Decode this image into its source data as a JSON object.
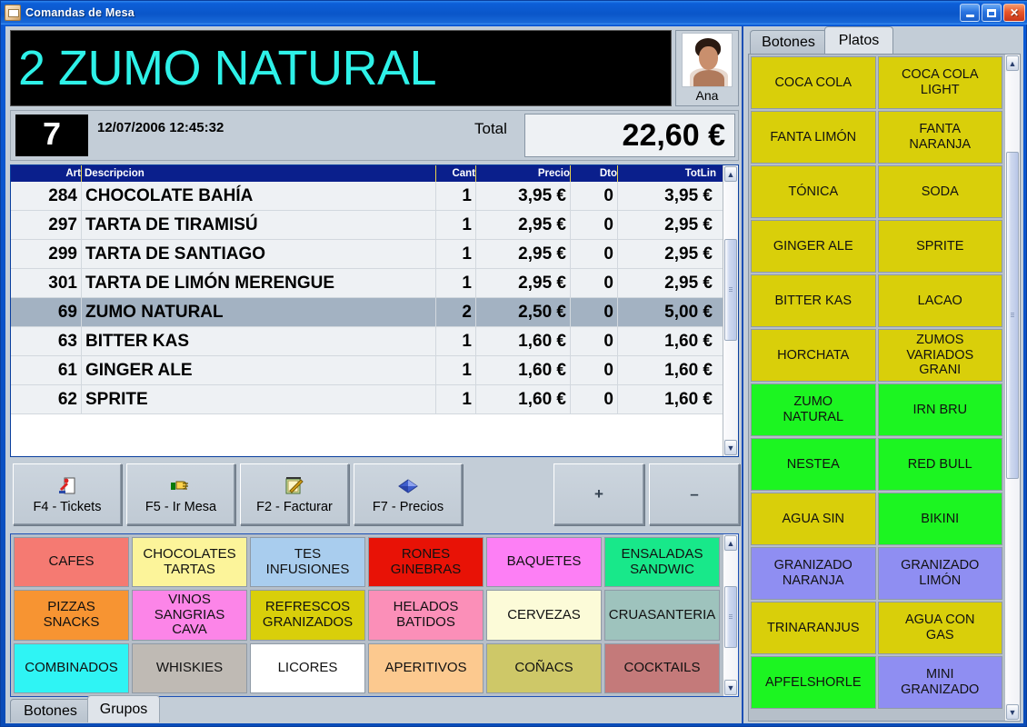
{
  "window": {
    "title": "Comandas de Mesa",
    "icon": "app-icon",
    "controls": {
      "minimize": "minimize-icon",
      "maximize": "maximize-icon",
      "close": "close-icon"
    }
  },
  "display": {
    "line": "2 ZUMO NATURAL",
    "color": "#2ef1e8"
  },
  "user": {
    "name": "Ana",
    "photo": "user-photo"
  },
  "info": {
    "table_number": "7",
    "datetime": "12/07/2006 12:45:32",
    "total_label": "Total",
    "total_value": "22,60 €"
  },
  "order_table": {
    "columns": [
      "Art",
      "Descripcion",
      "Cant",
      "Precio",
      "Dto",
      "TotLin"
    ],
    "header_bg": "#0a1f8c",
    "selected_row_bg": "#a3b2c2",
    "rows": [
      {
        "art": "284",
        "desc": "CHOCOLATE BAHÍA",
        "cant": "1",
        "precio": "3,95 €",
        "dto": "0",
        "totlin": "3,95 €",
        "selected": false
      },
      {
        "art": "297",
        "desc": "TARTA DE TIRAMISÚ",
        "cant": "1",
        "precio": "2,95 €",
        "dto": "0",
        "totlin": "2,95 €",
        "selected": false
      },
      {
        "art": "299",
        "desc": "TARTA DE SANTIAGO",
        "cant": "1",
        "precio": "2,95 €",
        "dto": "0",
        "totlin": "2,95 €",
        "selected": false
      },
      {
        "art": "301",
        "desc": "TARTA DE LIMÓN MERENGUE",
        "cant": "1",
        "precio": "2,95 €",
        "dto": "0",
        "totlin": "2,95 €",
        "selected": false
      },
      {
        "art": "69",
        "desc": "ZUMO NATURAL",
        "cant": "2",
        "precio": "2,50 €",
        "dto": "0",
        "totlin": "5,00 €",
        "selected": true
      },
      {
        "art": "63",
        "desc": "BITTER KAS",
        "cant": "1",
        "precio": "1,60 €",
        "dto": "0",
        "totlin": "1,60 €",
        "selected": false
      },
      {
        "art": "61",
        "desc": "GINGER ALE",
        "cant": "1",
        "precio": "1,60 €",
        "dto": "0",
        "totlin": "1,60 €",
        "selected": false
      },
      {
        "art": "62",
        "desc": "SPRITE",
        "cant": "1",
        "precio": "1,60 €",
        "dto": "0",
        "totlin": "1,60 €",
        "selected": false
      }
    ]
  },
  "function_buttons": [
    {
      "label": "F4 - Tickets",
      "icon": "ticket-person-icon"
    },
    {
      "label": "F5 - Ir Mesa",
      "icon": "pointing-hand-icon"
    },
    {
      "label": "F2 - Facturar",
      "icon": "invoice-pen-icon"
    },
    {
      "label": "F7 - Precios",
      "icon": "price-tag-icon"
    }
  ],
  "stepper": {
    "plus": "+",
    "minus": "–"
  },
  "categories": [
    {
      "label": "CAFES",
      "color": "#f57a72"
    },
    {
      "label": "CHOCOLATES\nTARTAS",
      "color": "#fcf49a"
    },
    {
      "label": "TES\nINFUSIONES",
      "color": "#a9cdee"
    },
    {
      "label": "RONES\nGINEBRAS",
      "color": "#e81206"
    },
    {
      "label": "BAQUETES",
      "color": "#fd7ff5"
    },
    {
      "label": "ENSALADAS\nSANDWIC",
      "color": "#18e88a"
    },
    {
      "label": "PIZZAS\nSNACKS",
      "color": "#f79432"
    },
    {
      "label": "VINOS\nSANGRIAS\nCAVA",
      "color": "#fc85e8"
    },
    {
      "label": "REFRESCOS\nGRANIZADOS",
      "color": "#d9cf0a"
    },
    {
      "label": "HELADOS\nBATIDOS",
      "color": "#fb8fb8"
    },
    {
      "label": "CERVEZAS",
      "color": "#fcfbd8"
    },
    {
      "label": "CRUASANTERIA",
      "color": "#9ec3bd"
    },
    {
      "label": "COMBINADOS",
      "color": "#2ff4f4"
    },
    {
      "label": "WHISKIES",
      "color": "#bfbab4"
    },
    {
      "label": "LICORES",
      "color": "#ffffff"
    },
    {
      "label": "APERITIVOS",
      "color": "#fcc98f"
    },
    {
      "label": "COÑACS",
      "color": "#cec868"
    },
    {
      "label": "COCKTAILS",
      "color": "#c47a7a"
    }
  ],
  "bottom_tabs": [
    {
      "label": "Botones",
      "active": false
    },
    {
      "label": "Grupos",
      "active": true
    }
  ],
  "right_panel": {
    "tabs": [
      {
        "label": "Botones",
        "active": false
      },
      {
        "label": "Platos",
        "active": true
      }
    ],
    "products": [
      {
        "label": "COCA COLA",
        "color": "#d9cf0a"
      },
      {
        "label": "COCA COLA\nLIGHT",
        "color": "#d9cf0a"
      },
      {
        "label": "FANTA LIMÓN",
        "color": "#d9cf0a"
      },
      {
        "label": "FANTA\nNARANJA",
        "color": "#d9cf0a"
      },
      {
        "label": "TÓNICA",
        "color": "#d9cf0a"
      },
      {
        "label": "SODA",
        "color": "#d9cf0a"
      },
      {
        "label": "GINGER ALE",
        "color": "#d9cf0a"
      },
      {
        "label": "SPRITE",
        "color": "#d9cf0a"
      },
      {
        "label": "BITTER KAS",
        "color": "#d9cf0a"
      },
      {
        "label": "LACAO",
        "color": "#d9cf0a"
      },
      {
        "label": "HORCHATA",
        "color": "#d9cf0a"
      },
      {
        "label": "ZUMOS\nVARIADOS\nGRANI",
        "color": "#d9cf0a"
      },
      {
        "label": "ZUMO\nNATURAL",
        "color": "#1cf521"
      },
      {
        "label": "IRN BRU",
        "color": "#1cf521"
      },
      {
        "label": "NESTEA",
        "color": "#1cf521"
      },
      {
        "label": "RED BULL",
        "color": "#1cf521"
      },
      {
        "label": "AGUA SIN",
        "color": "#d9cf0a"
      },
      {
        "label": "BIKINI",
        "color": "#1cf521"
      },
      {
        "label": "GRANIZADO\nNARANJA",
        "color": "#8f8ef2"
      },
      {
        "label": "GRANIZADO\nLIMÓN",
        "color": "#8f8ef2"
      },
      {
        "label": "TRINARANJUS",
        "color": "#d9cf0a"
      },
      {
        "label": "AGUA CON\nGAS",
        "color": "#d9cf0a"
      },
      {
        "label": "APFELSHORLE",
        "color": "#1cf521"
      },
      {
        "label": "MINI\nGRANIZADO",
        "color": "#8f8ef2"
      }
    ]
  }
}
